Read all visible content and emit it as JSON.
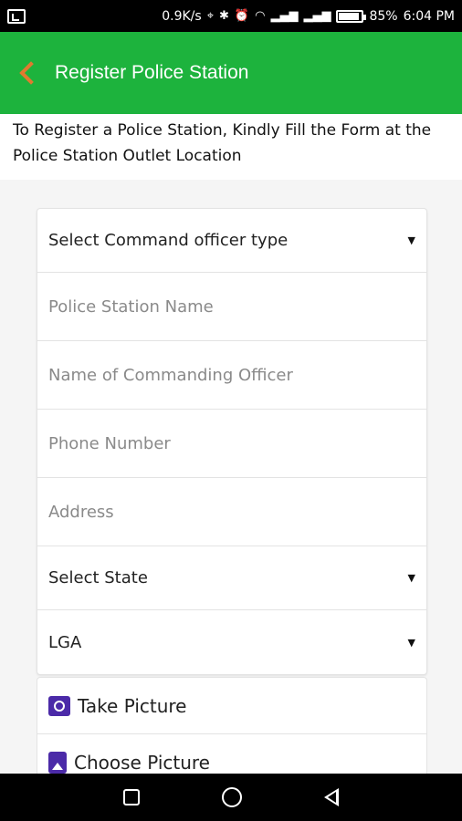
{
  "status_bar": {
    "speed": "0.9K/s",
    "battery": "85%",
    "time": "6:04 PM"
  },
  "app_bar": {
    "title": "Register Police Station"
  },
  "instructions": "To Register a Police Station, Kindly Fill the Form at the Police Station Outlet Location",
  "form": {
    "officer_type": "Select Command officer type",
    "station_name_placeholder": "Police Station Name",
    "officer_name_placeholder": "Name of Commanding Officer",
    "phone_placeholder": "Phone Number",
    "address_placeholder": "Address",
    "state": "Select State",
    "lga": "LGA"
  },
  "pictures": {
    "take": "Take Picture",
    "choose": "Choose Picture"
  },
  "colors": {
    "app_bar": "#1db33d",
    "back_arrow": "#e07a2f",
    "icon": "#4b2aa8"
  }
}
